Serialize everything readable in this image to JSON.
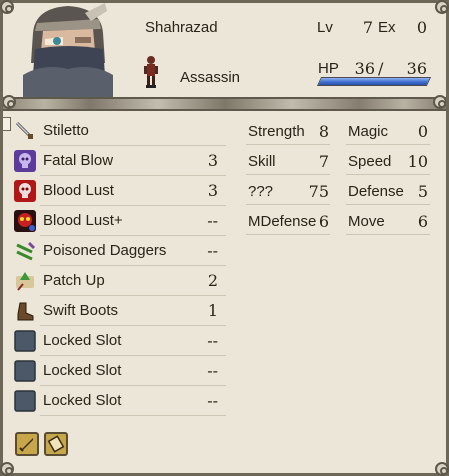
{
  "character": {
    "name": "Shahrazad",
    "class": "Assassin",
    "level_label": "Lv",
    "level": "7",
    "exp_label": "Ex",
    "exp": "0",
    "hp_label": "HP",
    "hp_current": "36",
    "hp_separator": "/",
    "hp_max": "36",
    "hp_fraction": 1.0
  },
  "inventory": [
    {
      "name": "Stiletto",
      "uses": "",
      "icon": "dagger-icon"
    },
    {
      "name": "Fatal Blow",
      "uses": "3",
      "icon": "fatal-blow-icon"
    },
    {
      "name": "Blood Lust",
      "uses": "3",
      "icon": "blood-lust-icon"
    },
    {
      "name": "Blood Lust+",
      "uses": "--",
      "icon": "blood-lust-plus-icon"
    },
    {
      "name": "Poisoned Daggers",
      "uses": "--",
      "icon": "poisoned-daggers-icon"
    },
    {
      "name": "Patch Up",
      "uses": "2",
      "icon": "patch-up-icon"
    },
    {
      "name": "Swift Boots",
      "uses": "1",
      "icon": "swift-boots-icon"
    },
    {
      "name": "Locked Slot",
      "uses": "--",
      "icon": "locked-slot-icon"
    },
    {
      "name": "Locked Slot",
      "uses": "--",
      "icon": "locked-slot-icon"
    },
    {
      "name": "Locked Slot",
      "uses": "--",
      "icon": "locked-slot-icon"
    }
  ],
  "stats": {
    "strength_label": "Strength",
    "strength": "8",
    "magic_label": "Magic",
    "magic": "0",
    "skill_label": "Skill",
    "skill": "7",
    "speed_label": "Speed",
    "speed": "10",
    "luck_label": "???",
    "luck": "75",
    "defense_label": "Defense",
    "defense": "5",
    "mdefense_label": "MDefense",
    "mdefense": "6",
    "move_label": "Move",
    "move": "6"
  },
  "bottom_buttons": [
    "sword-tab-icon",
    "scroll-tab-icon"
  ],
  "colors": {
    "panel_bg": "#ebe6d8",
    "hp_bar": "#3f6fd0",
    "frame": "#6d6757"
  }
}
